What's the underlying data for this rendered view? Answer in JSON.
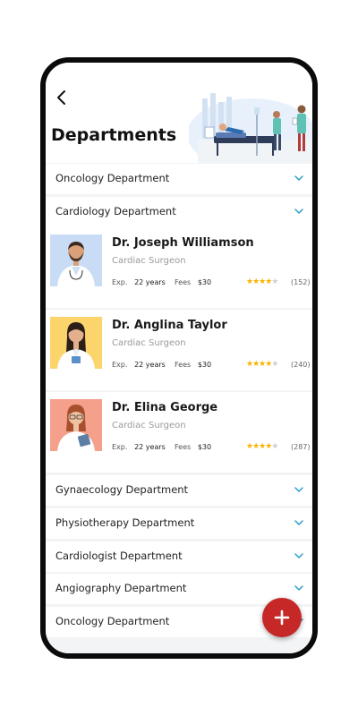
{
  "header": {
    "title": "Departments"
  },
  "departments_top": [
    {
      "label": "Oncology Department"
    },
    {
      "label": "Cardiology Department"
    }
  ],
  "doctors": [
    {
      "name": "Dr. Joseph Williamson",
      "specialty": "Cardiac Surgeon",
      "exp_label": "Exp.",
      "exp_value": "22 years",
      "fees_label": "Fees",
      "fees_value": "$30",
      "rating": 4,
      "reviews": "(152)",
      "photo_bg": "#c9dcf5"
    },
    {
      "name": "Dr. Anglina Taylor",
      "specialty": "Cardiac Surgeon",
      "exp_label": "Exp.",
      "exp_value": "22 years",
      "fees_label": "Fees",
      "fees_value": "$30",
      "rating": 4,
      "reviews": "(240)",
      "photo_bg": "#fcd46c"
    },
    {
      "name": "Dr. Elina George",
      "specialty": "Cardiac Surgeon",
      "exp_label": "Exp.",
      "exp_value": "22 years",
      "fees_label": "Fees",
      "fees_value": "$30",
      "rating": 4,
      "reviews": "(287)",
      "photo_bg": "#f4a08a"
    }
  ],
  "departments_bottom": [
    {
      "label": "Gynaecology Department"
    },
    {
      "label": "Physiotherapy Department"
    },
    {
      "label": "Cardiologist Department"
    },
    {
      "label": "Angiography Department"
    },
    {
      "label": "Oncology Department"
    }
  ],
  "fab": {
    "icon": "plus-icon",
    "color": "#c62828"
  },
  "colors": {
    "accent": "#1e9ac9",
    "star": "#f5b301"
  }
}
